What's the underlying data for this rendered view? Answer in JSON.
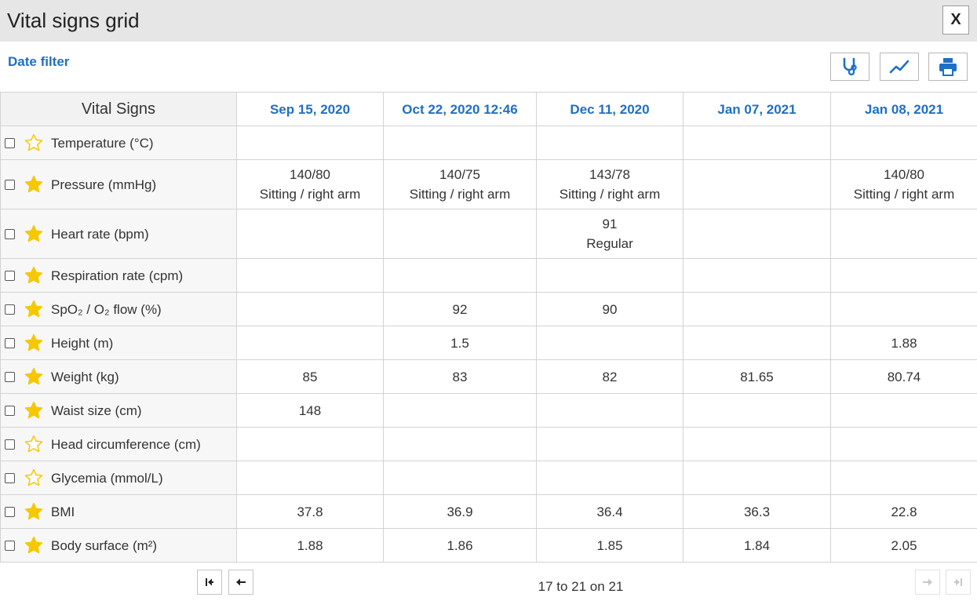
{
  "window": {
    "title": "Vital signs grid",
    "close_label": "X"
  },
  "toolbar": {
    "date_filter_label": "Date filter",
    "buttons": [
      {
        "icon": "stethoscope-icon"
      },
      {
        "icon": "chart-line-icon"
      },
      {
        "icon": "print-icon"
      }
    ]
  },
  "grid": {
    "header_label": "Vital Signs",
    "dates": [
      "Sep 15, 2020",
      "Oct 22, 2020 12:46",
      "Dec 11, 2020",
      "Jan 07, 2021",
      "Jan 08, 2021"
    ],
    "rows": [
      {
        "label": "Temperature (°C)",
        "favorite": false,
        "cells": [
          [],
          [],
          [],
          [],
          []
        ]
      },
      {
        "label": "Pressure (mmHg)",
        "favorite": true,
        "cells": [
          [
            "140/80",
            "Sitting / right arm"
          ],
          [
            "140/75",
            "Sitting / right arm"
          ],
          [
            "143/78",
            "Sitting / right arm"
          ],
          [],
          [
            "140/80",
            "Sitting / right arm"
          ]
        ]
      },
      {
        "label": "Heart rate (bpm)",
        "favorite": true,
        "cells": [
          [],
          [],
          [
            "91",
            "Regular"
          ],
          [],
          []
        ]
      },
      {
        "label": "Respiration rate (cpm)",
        "favorite": true,
        "cells": [
          [],
          [],
          [],
          [],
          []
        ]
      },
      {
        "label": "SpO₂ / O₂ flow (%)",
        "favorite": true,
        "cells": [
          [],
          [
            "92"
          ],
          [
            "90"
          ],
          [],
          []
        ]
      },
      {
        "label": "Height (m)",
        "favorite": true,
        "cells": [
          [],
          [
            "1.5"
          ],
          [],
          [],
          [
            "1.88"
          ]
        ]
      },
      {
        "label": "Weight (kg)",
        "favorite": true,
        "cells": [
          [
            "85"
          ],
          [
            "83"
          ],
          [
            "82"
          ],
          [
            "81.65"
          ],
          [
            "80.74"
          ]
        ]
      },
      {
        "label": "Waist size (cm)",
        "favorite": true,
        "cells": [
          [
            "148"
          ],
          [],
          [],
          [],
          []
        ]
      },
      {
        "label": "Head circumference (cm)",
        "favorite": false,
        "cells": [
          [],
          [],
          [],
          [],
          []
        ]
      },
      {
        "label": "Glycemia (mmol/L)",
        "favorite": false,
        "cells": [
          [],
          [],
          [],
          [],
          []
        ]
      },
      {
        "label": "BMI",
        "favorite": true,
        "cells": [
          [
            "37.8"
          ],
          [
            "36.9"
          ],
          [
            "36.4"
          ],
          [
            "36.3"
          ],
          [
            "22.8"
          ]
        ]
      },
      {
        "label": "Body surface (m²)",
        "favorite": true,
        "cells": [
          [
            "1.88"
          ],
          [
            "1.86"
          ],
          [
            "1.85"
          ],
          [
            "1.84"
          ],
          [
            "2.05"
          ]
        ]
      }
    ]
  },
  "pager": {
    "text": "17 to 21 on 21",
    "first_enabled": true,
    "prev_enabled": true,
    "next_enabled": false,
    "last_enabled": false
  },
  "colors": {
    "accent": "#1f6fc5",
    "star_filled": "#f5c800",
    "titlebar": "#e6e6e6",
    "label_bg": "#f7f7f7",
    "border": "#d3d3d3"
  }
}
